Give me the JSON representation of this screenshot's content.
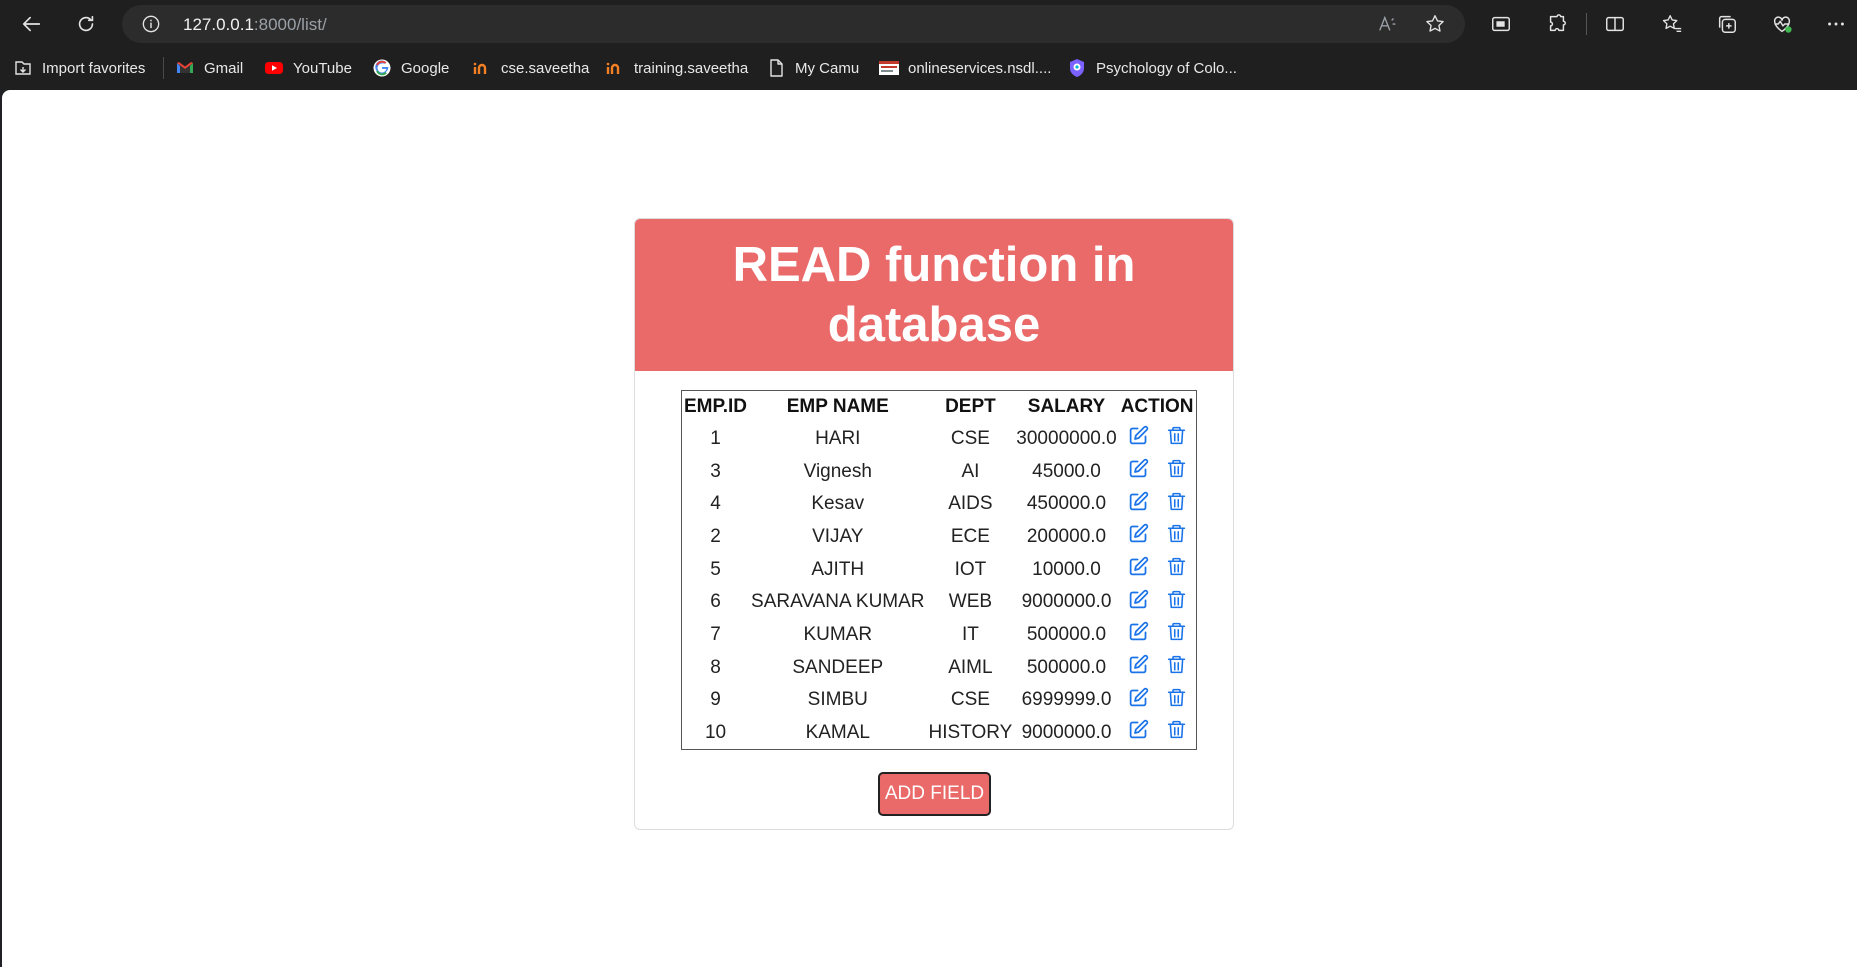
{
  "browser": {
    "url_host": "127.0.0.1",
    "url_path": ":8000/list/",
    "bookmarks": [
      {
        "label": "Import favorites",
        "icon": "import-favorites-icon"
      },
      {
        "label": "Gmail",
        "icon": "gmail-icon"
      },
      {
        "label": "YouTube",
        "icon": "youtube-icon"
      },
      {
        "label": "Google",
        "icon": "google-icon"
      },
      {
        "label": "cse.saveetha",
        "icon": "saveetha-icon"
      },
      {
        "label": "training.saveetha",
        "icon": "saveetha-icon"
      },
      {
        "label": "My Camu",
        "icon": "page-icon"
      },
      {
        "label": "onlineservices.nsdl....",
        "icon": "nsdl-icon"
      },
      {
        "label": "Psychology of Colo...",
        "icon": "shield-logo-icon"
      }
    ]
  },
  "page": {
    "title": "READ function in database",
    "table": {
      "headers": [
        "EMP.ID",
        "EMP NAME",
        "DEPT",
        "SALARY",
        "ACTION"
      ],
      "rows": [
        {
          "id": "1",
          "name": "HARI",
          "dept": "CSE",
          "salary": "30000000.0"
        },
        {
          "id": "3",
          "name": "Vignesh",
          "dept": "AI",
          "salary": "45000.0"
        },
        {
          "id": "4",
          "name": "Kesav",
          "dept": "AIDS",
          "salary": "450000.0"
        },
        {
          "id": "2",
          "name": "VIJAY",
          "dept": "ECE",
          "salary": "200000.0"
        },
        {
          "id": "5",
          "name": "AJITH",
          "dept": "IOT",
          "salary": "10000.0"
        },
        {
          "id": "6",
          "name": "SARAVANA KUMAR",
          "dept": "WEB",
          "salary": "9000000.0"
        },
        {
          "id": "7",
          "name": "KUMAR",
          "dept": "IT",
          "salary": "500000.0"
        },
        {
          "id": "8",
          "name": "SANDEEP",
          "dept": "AIML",
          "salary": "500000.0"
        },
        {
          "id": "9",
          "name": "SIMBU",
          "dept": "CSE",
          "salary": "6999999.0"
        },
        {
          "id": "10",
          "name": "KAMAL",
          "dept": "HISTORY",
          "salary": "9000000.0"
        }
      ]
    },
    "add_button_label": "ADD FIELD"
  },
  "colors": {
    "header_bg": "#ea6a6a",
    "action_icon": "#1a73e8"
  }
}
